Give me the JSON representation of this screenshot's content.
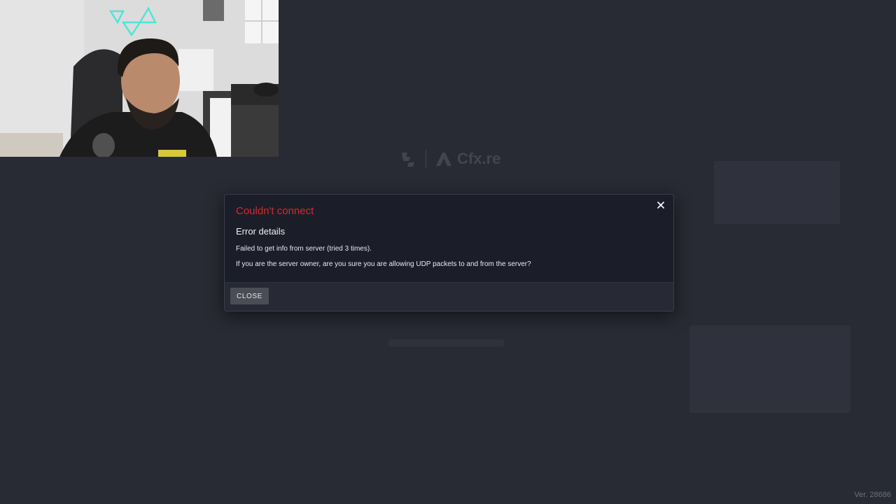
{
  "background": {
    "brand_text": "Cfx.re",
    "version": "Ver. 28686"
  },
  "dialog": {
    "title": "Couldn't connect",
    "section_title": "Error details",
    "message_1": "Failed to get info from server (tried 3 times).",
    "message_2": "If you are the server owner, are you sure you are allowing UDP packets to and from the server?",
    "close_button_label": "CLOSE",
    "close_icon": "close-icon"
  },
  "colors": {
    "background": "#282a34",
    "dialog_bg": "#1b1e29",
    "dialog_footer_bg": "#272a34",
    "error_title": "#d22b2b",
    "button_bg": "#4a4d56"
  }
}
